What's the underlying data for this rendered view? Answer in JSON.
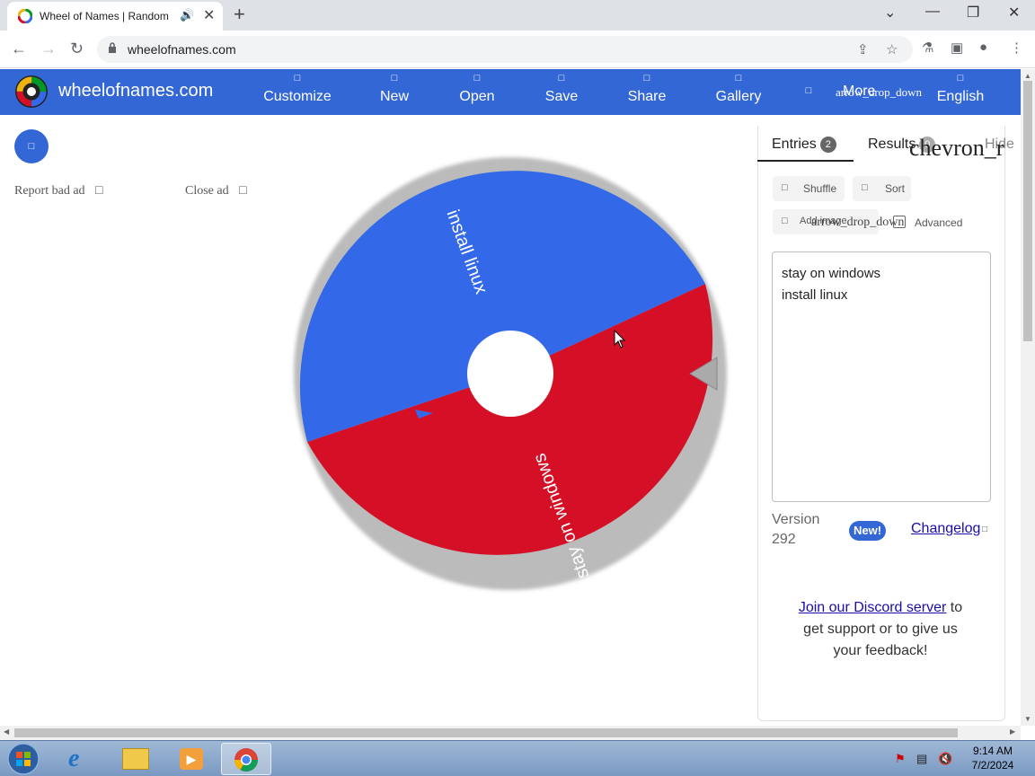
{
  "browser": {
    "tab_title": "Wheel of Names | Random",
    "tab_audio_icon": "speaker-icon",
    "tab_close": "✕",
    "new_tab": "+",
    "url": "wheelofnames.com"
  },
  "site": {
    "brand": "wheelofnames.com",
    "menu": [
      {
        "icon": "□",
        "label": "Customize"
      },
      {
        "icon": "□",
        "label": "New"
      },
      {
        "icon": "□",
        "label": "Open"
      },
      {
        "icon": "□",
        "label": "Save"
      },
      {
        "icon": "□",
        "label": "Share"
      },
      {
        "icon": "□",
        "label": "Gallery"
      },
      {
        "icon": "□",
        "label": ""
      },
      {
        "icon": "",
        "label": "arrow_drop_down"
      },
      {
        "icon": "",
        "label": "More"
      },
      {
        "icon": "□",
        "label": "English"
      }
    ],
    "menu_circle_icon": "□"
  },
  "ads": {
    "report": "Report bad ad",
    "report_icon": "□",
    "close": "Close ad",
    "close_icon": "□"
  },
  "wheel": {
    "segments": [
      {
        "label": "stay on windows",
        "color": "#3369e8"
      },
      {
        "label": "install linux",
        "color": "#d50f25"
      }
    ]
  },
  "panel": {
    "tabs": {
      "entries": "Entries",
      "entries_count": "2",
      "results": "Results",
      "results_count": "0",
      "hide": "Hide",
      "chevron": "chevron_r"
    },
    "buttons": {
      "shuffle": "Shuffle",
      "sort": "Sort",
      "add_image": "Add image",
      "add_image_dropdown": "arrow_drop_down",
      "advanced": "Advanced",
      "icon": "□"
    },
    "entries_text": [
      "stay on windows",
      "install linux"
    ],
    "version_label": "Version",
    "version_number": "292",
    "new_badge": "New!",
    "changelog": "Changelog",
    "changelog_icon": "□",
    "discord_link": "Join our Discord server",
    "discord_text": " to get support or to give us your feedback!"
  },
  "taskbar": {
    "time": "9:14 AM",
    "date": "7/2/2024"
  },
  "colors": {
    "accent": "#3367d6",
    "wheel_blue": "#3369e8",
    "wheel_red": "#d50f25"
  }
}
